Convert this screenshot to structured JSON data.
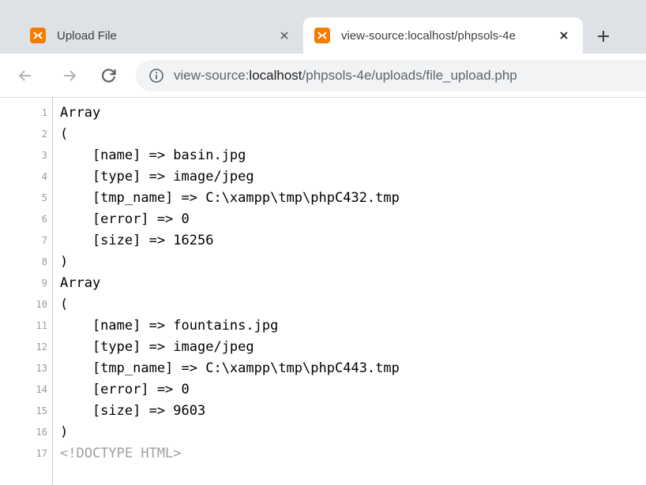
{
  "tabs": [
    {
      "title": "Upload File",
      "active": false,
      "favicon": "xampp-icon",
      "close": "×"
    },
    {
      "title": "view-source:localhost/phpsols-4e",
      "active": true,
      "favicon": "xampp-icon",
      "close": "×"
    }
  ],
  "new_tab_label": "+",
  "toolbar": {
    "back": "back-arrow-icon",
    "forward": "forward-arrow-icon",
    "reload": "reload-icon",
    "url_prefix": "view-source:",
    "url_host": "localhost",
    "url_path": "/phpsols-4e/uploads/file_upload.php"
  },
  "source_lines": [
    {
      "num": "1",
      "text": "Array"
    },
    {
      "num": "2",
      "text": "("
    },
    {
      "num": "3",
      "text": "    [name] => basin.jpg"
    },
    {
      "num": "4",
      "text": "    [type] => image/jpeg"
    },
    {
      "num": "5",
      "text": "    [tmp_name] => C:\\xampp\\tmp\\phpC432.tmp"
    },
    {
      "num": "6",
      "text": "    [error] => 0"
    },
    {
      "num": "7",
      "text": "    [size] => 16256"
    },
    {
      "num": "8",
      "text": ")"
    },
    {
      "num": "9",
      "text": "Array"
    },
    {
      "num": "10",
      "text": "("
    },
    {
      "num": "11",
      "text": "    [name] => fountains.jpg"
    },
    {
      "num": "12",
      "text": "    [type] => image/jpeg"
    },
    {
      "num": "13",
      "text": "    [tmp_name] => C:\\xampp\\tmp\\phpC443.tmp"
    },
    {
      "num": "14",
      "text": "    [error] => 0"
    },
    {
      "num": "15",
      "text": "    [size] => 9603"
    },
    {
      "num": "16",
      "text": ")"
    },
    {
      "num": "17",
      "text": "<!DOCTYPE HTML>"
    }
  ],
  "colors": {
    "favicon": "#f57c00",
    "doctype": "#a0a0a0",
    "tabstrip": "#dee1e6"
  }
}
